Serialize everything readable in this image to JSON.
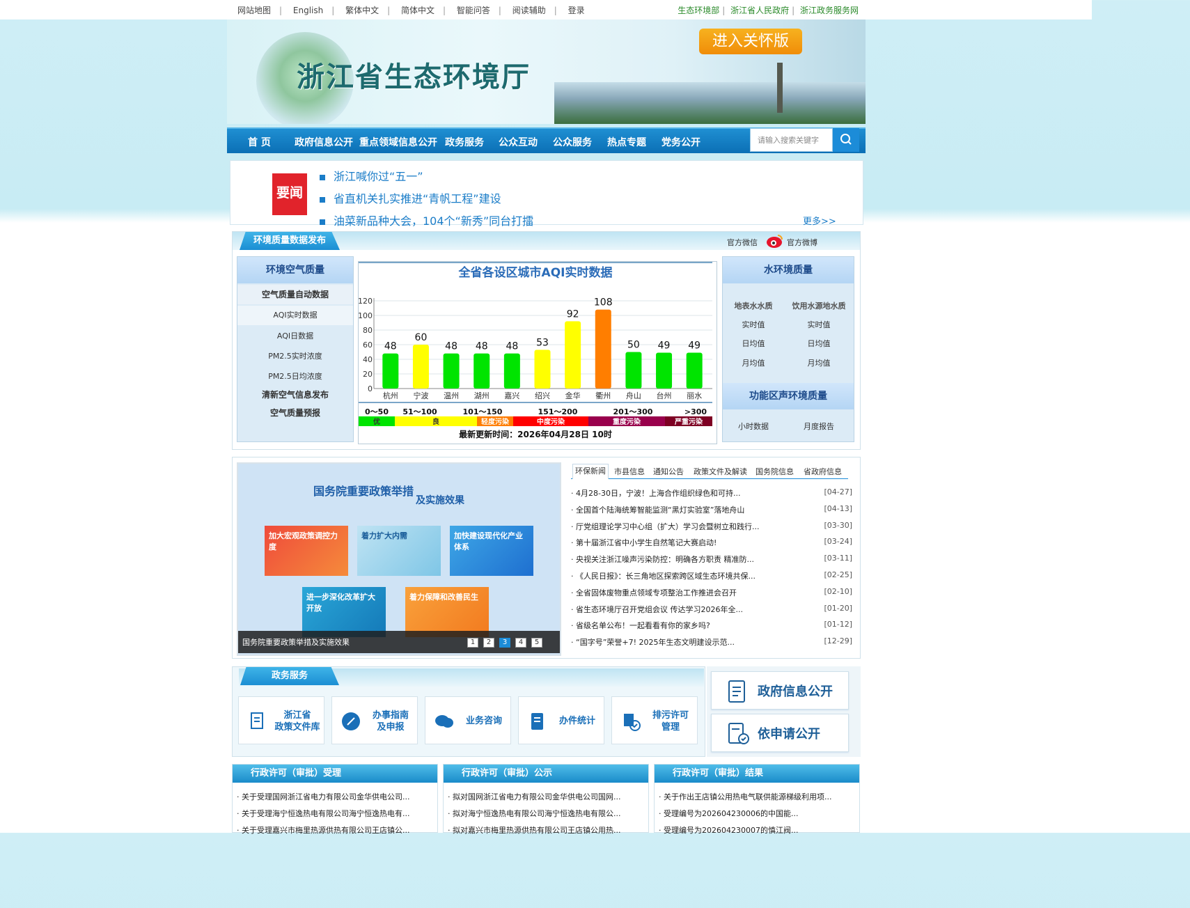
{
  "topbar": {
    "left": [
      "网站地图",
      "English",
      "繁体中文",
      "简体中文",
      "智能问答",
      "阅读辅助",
      "登录"
    ],
    "right": [
      "生态环境部",
      "浙江省人民政府",
      "浙江政务服务网"
    ]
  },
  "header": {
    "title": "浙江省生态环境厅",
    "care_button": "进入关怀版"
  },
  "nav": {
    "items": [
      "首  页",
      "政府信息公开",
      "重点领域信息公开",
      "政务服务",
      "公众互动",
      "公众服务",
      "热点专题",
      "党务公开"
    ],
    "search_placeholder": "请输入搜索关键字"
  },
  "news": {
    "badge": "要闻",
    "items": [
      "浙江喊你过“五一”",
      "省直机关扎实推进“青帆工程”建设",
      "油菜新品种大会，104个“新秀”同台打擂"
    ],
    "more": "更多>>"
  },
  "env": {
    "tab": "环境质量数据发布",
    "wechat": "官方微信",
    "weibo": "官方微博",
    "air": {
      "title": "环境空气质量",
      "items": [
        "空气质量自动数据",
        "AQI实时数据",
        "AQI日数据",
        "PM2.5实时浓度",
        "PM2.5日均浓度",
        "清新空气信息发布",
        "空气质量预报"
      ]
    },
    "water": {
      "title": "水环境质量",
      "col1": [
        "地表水水质",
        "实时值",
        "日均值",
        "月均值"
      ],
      "col2": [
        "饮用水源地水质",
        "实时值",
        "日均值",
        "月均值"
      ]
    },
    "noise": {
      "title": "功能区声环境质量",
      "items": [
        "小时数据",
        "月度报告"
      ]
    }
  },
  "chart_data": {
    "type": "bar",
    "title": "全省各设区城市AQI实时数据",
    "categories": [
      "杭州",
      "宁波",
      "温州",
      "湖州",
      "嘉兴",
      "绍兴",
      "金华",
      "衢州",
      "舟山",
      "台州",
      "丽水"
    ],
    "values": [
      48,
      60,
      48,
      48,
      48,
      53,
      92,
      108,
      50,
      49,
      49
    ],
    "ylim": [
      0,
      120
    ],
    "yticks": [
      0,
      20,
      40,
      60,
      80,
      100,
      120
    ],
    "grid": true,
    "legend": [
      {
        "range": "0～50",
        "label": "优",
        "color": "#00e400"
      },
      {
        "range": "51～100",
        "label": "良",
        "color": "#ffff00"
      },
      {
        "range": "101～150",
        "label": "轻度污染",
        "color": "#ff7e00"
      },
      {
        "range": "151～200",
        "label": "中度污染",
        "color": "#ff0000"
      },
      {
        "range": "201～300",
        "label": "重度污染",
        "color": "#99004c"
      },
      {
        "range": ">300",
        "label": "严重污染",
        "color": "#7e0023"
      }
    ],
    "update": "最新更新时间：2026年04月28日 10时"
  },
  "slider": {
    "headline": "国务院重要政策举措",
    "subline": "及实施效果",
    "tiles": [
      "加大宏观政策调控力度",
      "着力扩大内需",
      "加快建设现代化产业体系",
      "进一步深化改革扩大开放",
      "着力保障和改善民生"
    ],
    "caption": "国务院重要政策举措及实施效果",
    "pages": [
      "1",
      "2",
      "3",
      "4",
      "5"
    ],
    "active_page": "3"
  },
  "tabs": [
    "环保新闻",
    "市县信息",
    "通知公告",
    "政策文件及解读",
    "国务院信息",
    "省政府信息"
  ],
  "newslist": [
    {
      "t": "4月28-30日，宁波！上海合作组织绿色和可持...",
      "d": "[04-27]"
    },
    {
      "t": "全国首个陆海统筹智能监测“黑灯实验室”落地舟山",
      "d": "[04-13]"
    },
    {
      "t": "厅党组理论学习中心组（扩大）学习会暨树立和践行...",
      "d": "[03-30]"
    },
    {
      "t": "第十届浙江省中小学生自然笔记大赛启动!",
      "d": "[03-24]"
    },
    {
      "t": "央视关注浙江噪声污染防控：明确各方职责 精准防...",
      "d": "[03-11]"
    },
    {
      "t": "《人民日报》：长三角地区探索跨区域生态环境共保...",
      "d": "[02-25]"
    },
    {
      "t": "全省固体废物重点领域专项整治工作推进会召开",
      "d": "[02-10]"
    },
    {
      "t": "省生态环境厅召开党组会议 传达学习2026年全...",
      "d": "[01-20]"
    },
    {
      "t": "省级名单公布！一起看看有你的家乡吗?",
      "d": "[01-12]"
    },
    {
      "t": "“国字号”荣誉+7! 2025年生态文明建设示范...",
      "d": "[12-29]"
    }
  ],
  "services": {
    "tab": "政务服务",
    "items": [
      "浙江省\n政策文件库",
      "办事指南\n及申报",
      "业务咨询",
      "办件统计",
      "排污许可\n管理"
    ],
    "big": [
      "政府信息公开",
      "依申请公开"
    ]
  },
  "bottom": [
    {
      "title": "行政许可（审批）受理",
      "items": [
        "关于受理国网浙江省电力有限公司金华供电公司...",
        "关于受理海宁恒逸热电有限公司海宁恒逸热电有...",
        "关于受理嘉兴市梅里热源供热有限公司王店镇公..."
      ]
    },
    {
      "title": "行政许可（审批）公示",
      "items": [
        "拟对国网浙江省电力有限公司金华供电公司国网...",
        "拟对海宁恒逸热电有限公司海宁恒逸热电有限公...",
        "拟对嘉兴市梅里热源供热有限公司王店镇公用热..."
      ]
    },
    {
      "title": "行政许可（审批）结果",
      "items": [
        "关于作出王店镇公用热电气联供能源梯级利用项...",
        "受理编号为202604230006的中国能...",
        "受理编号为202604230007的慎江阀..."
      ]
    }
  ]
}
